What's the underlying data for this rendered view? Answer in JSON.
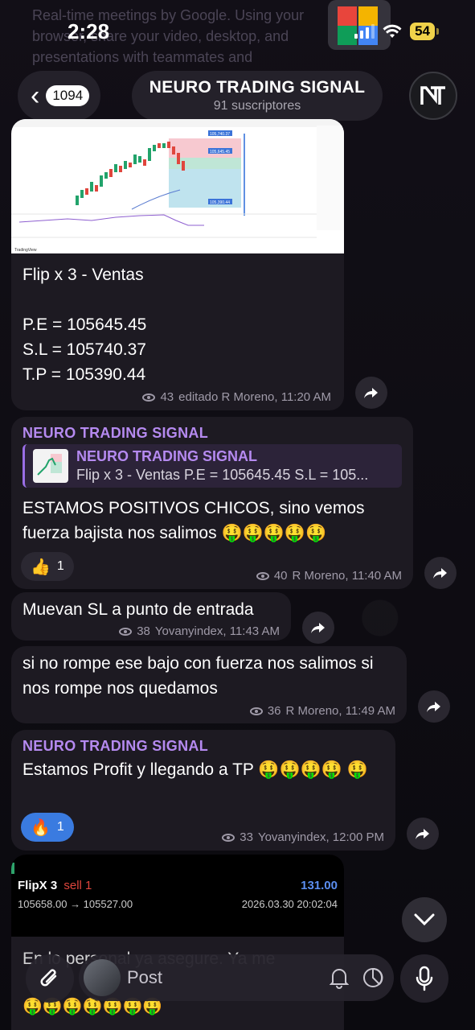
{
  "status": {
    "time": "2:28",
    "battery": "54"
  },
  "ghost": {
    "text": "Real-time meetings by Google. Using your browser, share your video, desktop, and presentations with teammates and"
  },
  "header": {
    "back_count": "1094",
    "channel_name": "NEURO TRADING SIGNAL",
    "subscribers": "91 suscriptores",
    "avatar_glyph": "N"
  },
  "messages": [
    {
      "id": "m1",
      "has_chart": true,
      "lines": [
        "Flip x 3 - Ventas",
        "",
        "P.E = 105645.45",
        "S.L = 105740.37",
        "T.P = 105390.44"
      ],
      "views": "43",
      "meta": "editado R Moreno, 11:20 AM",
      "chart_labels": {
        "top": "105,740.37",
        "entry": "105,645.45",
        "tp": "105,390.44"
      },
      "chart_footer": "TradingView"
    },
    {
      "id": "m2",
      "sender": "NEURO TRADING SIGNAL",
      "reply_title": "NEURO TRADING SIGNAL",
      "reply_body": "Flip x 3 - Ventas P.E = 105645.45 S.L = 105...",
      "text": "ESTAMOS POSITIVOS CHICOS, sino vemos fuerza bajista nos salimos 🤑🤑🤑🤑🤑",
      "reaction_emoji": "👍",
      "reaction_count": "1",
      "views": "40",
      "meta": "R Moreno, 11:40 AM"
    },
    {
      "id": "m3",
      "text": "Muevan SL a punto de entrada",
      "views": "38",
      "meta": "Yovanyindex, 11:43 AM"
    },
    {
      "id": "m4",
      "text": "si no rompe ese bajo con fuerza nos salimos si nos rompe nos quedamos",
      "views": "36",
      "meta": "R Moreno, 11:49 AM"
    },
    {
      "id": "m5",
      "sender": "NEURO TRADING SIGNAL",
      "text": "Estamos Profit y llegando a TP 🤑🤑🤑🤑 🤑",
      "reaction_emoji": "🔥",
      "reaction_count": "1",
      "views": "33",
      "meta": "Yovanyindex, 12:00 PM"
    },
    {
      "id": "m6",
      "trade_symbol": "FlipX 3",
      "trade_side": "sell 1",
      "trade_pnl": "131.00",
      "trade_prices": "105658.00 → 105527.00",
      "trade_date": "2026.03.30 20:02:04",
      "text_partial": "En lo personal ya asegure. Ya me",
      "emoji_row": "🤑🤑🤑🤑🤑🤑🤑"
    }
  ],
  "input": {
    "placeholder": "Post"
  }
}
